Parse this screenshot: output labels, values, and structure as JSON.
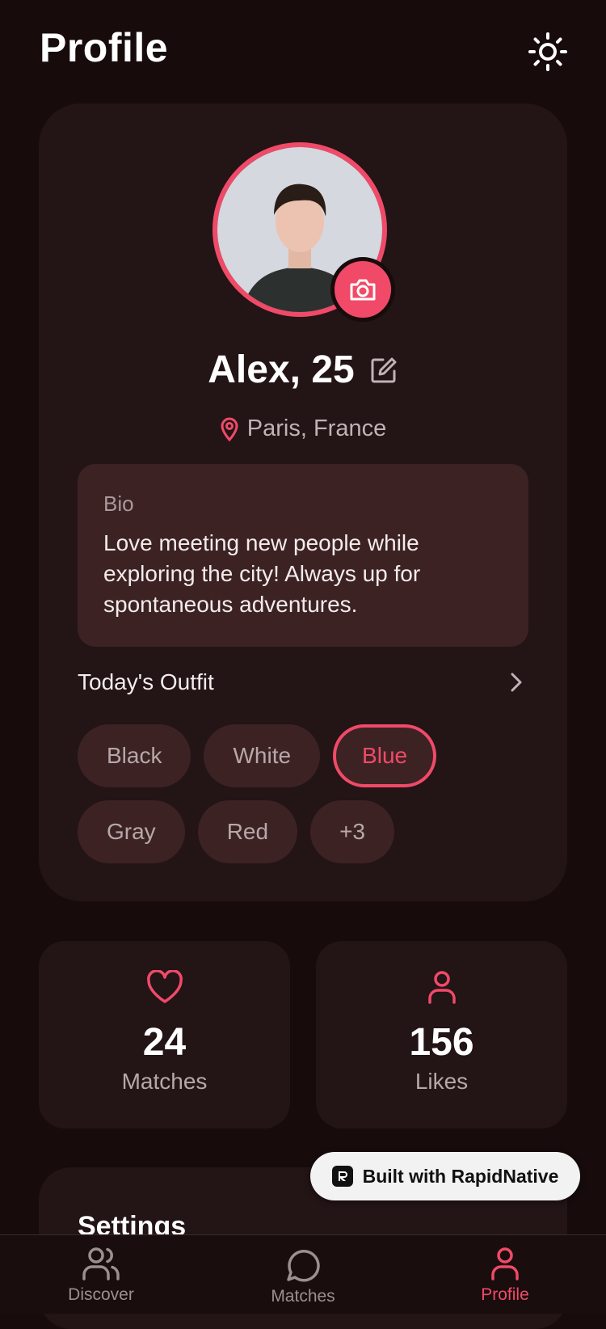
{
  "header": {
    "title": "Profile"
  },
  "profile": {
    "name": "Alex, 25",
    "location": "Paris, France",
    "bio_label": "Bio",
    "bio_text": "Love meeting new people while exploring the city! Always up for spontaneous adventures."
  },
  "outfit": {
    "title": "Today's Outfit",
    "colors": [
      "Black",
      "White",
      "Blue",
      "Gray",
      "Red",
      "+3"
    ],
    "selected": "Blue"
  },
  "stats": {
    "matches_value": "24",
    "matches_label": "Matches",
    "likes_value": "156",
    "likes_label": "Likes"
  },
  "settings": {
    "title": "Settings"
  },
  "badge": {
    "label": "Built with RapidNative"
  },
  "tabs": [
    {
      "label": "Discover"
    },
    {
      "label": "Matches"
    },
    {
      "label": "Profile"
    }
  ],
  "theme": {
    "accent": "#f04a68",
    "background": "#170b0c",
    "card": "#231416",
    "chip": "#3d2224"
  }
}
